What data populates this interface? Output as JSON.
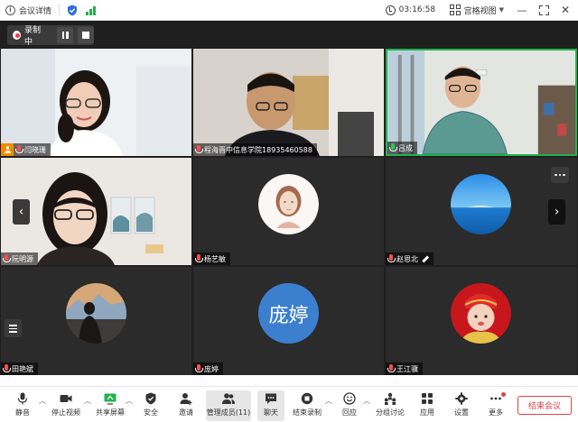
{
  "topbar": {
    "title": "会议详情",
    "time": "03:16:58",
    "view_label": "宫格视图"
  },
  "recording": {
    "label": "录制中"
  },
  "participants": [
    {
      "name": "闫晓珊",
      "mic": "red",
      "host": true
    },
    {
      "name": "程海晋中信息学院18935460588",
      "mic": "red",
      "host": false
    },
    {
      "name": "吕成",
      "mic": "green",
      "host": false,
      "active": true
    },
    {
      "name": "阮明源",
      "mic": "red",
      "host": false
    },
    {
      "name": "杨艺敏",
      "mic": "red",
      "host": false
    },
    {
      "name": "赵恩北",
      "mic": "red",
      "host": false,
      "editing": true
    },
    {
      "name": "田艳斌",
      "mic": "red",
      "host": false
    },
    {
      "name": "庞婷",
      "mic": "red",
      "host": false,
      "avatar_text": "庞婷"
    },
    {
      "name": "王江骥",
      "mic": "red",
      "host": false
    }
  ],
  "toolbar": {
    "mute": "静音",
    "stop_video": "停止视频",
    "share_screen": "共享屏幕",
    "security": "安全",
    "invite": "邀请",
    "manage_members": "管理成员(11)",
    "chat": "聊天",
    "stop_recording": "结束录制",
    "reactions": "回应",
    "breakout": "分组讨论",
    "apps": "应用",
    "settings": "设置",
    "more": "更多",
    "end_meeting": "结束会议"
  },
  "colors": {
    "accent_green": "#22b14c",
    "end_red": "#e24040",
    "host_orange": "#f08c00",
    "avatar_blue": "#3c7fcf"
  }
}
